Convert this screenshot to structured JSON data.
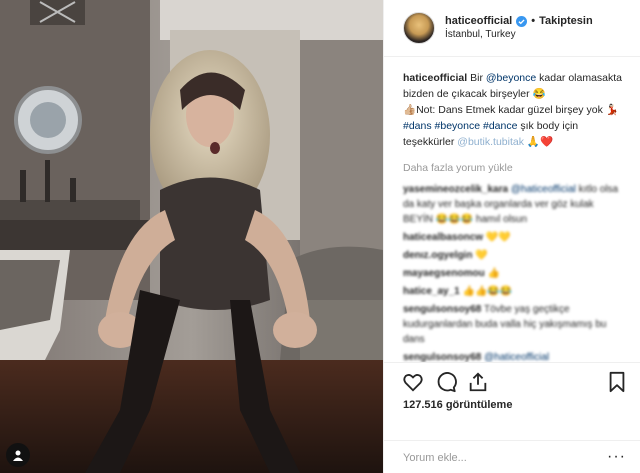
{
  "post": {
    "username": "haticeofficial",
    "separator": "•",
    "follow_label": "Takiptesin",
    "location": "İstanbul, Turkey"
  },
  "caption": {
    "username": "haticeofficial",
    "part1": " Bir ",
    "mention1": "@beyonce",
    "part2": " kadar olamasakta bizden de çıkacak birşeyler 😂",
    "part3": "👍🏼Not: Dans Etmek kadar güzel birşey yok 💃🏻",
    "tag1": "#dans",
    "tag2": "#beyonce",
    "tag3": "#dance",
    "part4": " şık body için teşekkürler ",
    "mention2": "@butik.tubitak",
    "part5": " 🙏❤️"
  },
  "load_more": "Daha fazla yorum yükle",
  "comments": [
    {
      "user": "yasemineozcelik_kara",
      "mention": "@haticeofficial",
      "text": "kıtlo olsa da katy ver başka organlarda ver göz kulak BEYİN 😂😂😂 hamıl olsun"
    },
    {
      "user": "haticealbasoncw",
      "text": "💛💛"
    },
    {
      "user": "denız.ogyelgin",
      "text": "💛"
    },
    {
      "user": "mayaegsenomou",
      "text": "👍"
    },
    {
      "user": "hatice_ay_1",
      "text": "👍👍😂😂"
    },
    {
      "user": "sengulsonsoy68",
      "text": "Tövbe yaş geçtikçe kudurganlardan buda valla hiç yakışmamış bu dans"
    },
    {
      "user": "sengulsonsoy68",
      "mention": "@haticeofficial",
      "text": ""
    }
  ],
  "views": "127.516 görüntüleme",
  "add_comment": "Yorum ekle...",
  "options_icon": "···",
  "colors": {
    "link": "#003569",
    "muted": "#999999",
    "verified": "#3897f0",
    "heart": "#e0245e"
  }
}
